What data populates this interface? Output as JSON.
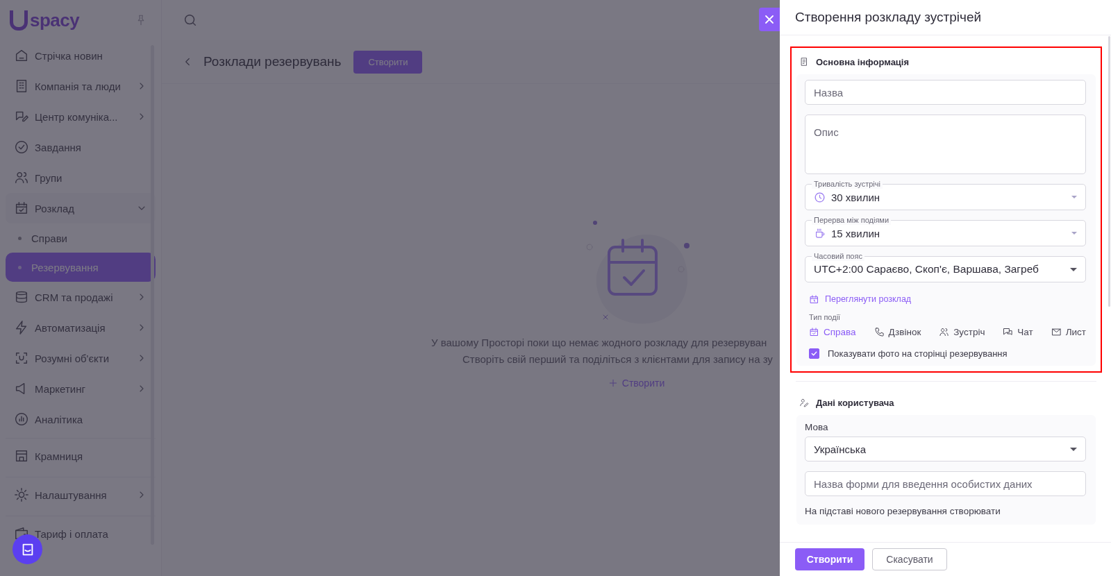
{
  "sidebar": {
    "logo": "spacy",
    "items": [
      {
        "label": "Стрічка новин",
        "expandable": false,
        "separated": false
      },
      {
        "label": "Компанія та люди",
        "expandable": true,
        "expanded": false,
        "separated": false
      },
      {
        "label": "Центр комуніка...",
        "expandable": true,
        "expanded": false,
        "separated": false
      },
      {
        "label": "Завдання",
        "expandable": false,
        "separated": false
      },
      {
        "label": "Групи",
        "expandable": false,
        "separated": false
      },
      {
        "label": "Розклад",
        "expandable": true,
        "expanded": true,
        "separated": false,
        "children": [
          {
            "label": "Справи",
            "selected": false
          },
          {
            "label": "Резервування",
            "selected": true
          }
        ]
      },
      {
        "label": "CRM та продажі",
        "expandable": true,
        "expanded": false,
        "separated": false
      },
      {
        "label": "Автоматизація",
        "expandable": true,
        "expanded": false,
        "separated": false
      },
      {
        "label": "Розумні об'єкти",
        "expandable": true,
        "expanded": false,
        "separated": false
      },
      {
        "label": "Маркетинг",
        "expandable": true,
        "expanded": false,
        "separated": false
      },
      {
        "label": "Аналітика",
        "expandable": false,
        "separated": false
      },
      {
        "label": "Крамниця",
        "expandable": false,
        "separated": true
      },
      {
        "label": "Налаштування",
        "expandable": true,
        "expanded": false,
        "separated": true
      },
      {
        "label": "Тариф і оплата",
        "expandable": false,
        "separated": true
      }
    ]
  },
  "page": {
    "title": "Розклади резервувань",
    "create_button": "Створити",
    "empty_state": {
      "lines": [
        "У вашому Просторі поки що немає жодного розкладу для резервуван",
        "Створіть свій перший та поділіться з клієнтами для запису на зу"
      ],
      "create_link": "Створити"
    }
  },
  "drawer": {
    "title": "Створення розкладу зустрічей",
    "main_section": {
      "title": "Основна інформація",
      "highlighted": true,
      "name_field": {
        "placeholder": "Назва"
      },
      "description_field": {
        "placeholder": "Опис"
      },
      "selects": [
        {
          "label": "Тривалість зустрічі",
          "value": "30 хвилин",
          "kind": "duration"
        },
        {
          "label": "Перерва між подіями",
          "value": "15 хвилин",
          "kind": "break"
        },
        {
          "label": "Часовий пояс",
          "value": "UTC+2:00 Сараєво, Скоп'є, Варшава, Загреб",
          "kind": "plain"
        }
      ],
      "view_link": "Переглянути розклад",
      "event_type_label": "Тип події",
      "event_types": [
        {
          "label": "Справа",
          "selected": true
        },
        {
          "label": "Дзвінок",
          "selected": false
        },
        {
          "label": "Зустріч",
          "selected": false
        },
        {
          "label": "Чат",
          "selected": false
        },
        {
          "label": "Лист",
          "selected": false
        }
      ],
      "show_photo": {
        "label": "Показувати фото на сторінці резервування",
        "checked": true
      }
    },
    "user_section": {
      "title": "Дані користувача",
      "language_label": "Мова",
      "language_value": "Українська",
      "form_name_field": {
        "placeholder": "Назва форми для введення особистих даних"
      },
      "create_on_booking": "На підставі нового резервування створювати"
    },
    "buttons": {
      "primary": "Створити",
      "secondary": "Скасувати"
    }
  }
}
